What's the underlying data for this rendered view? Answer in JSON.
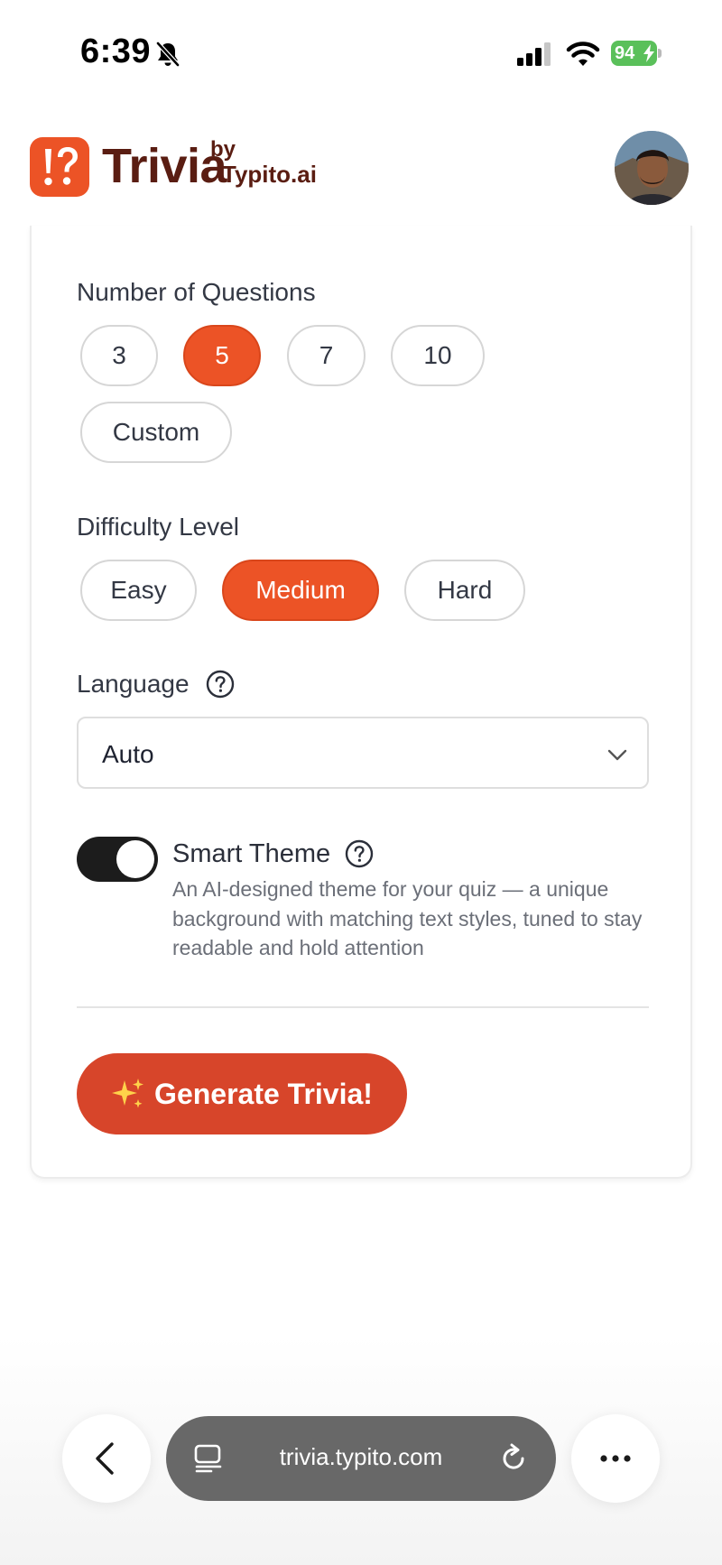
{
  "status_bar": {
    "time": "6:39",
    "battery": "94",
    "icons": [
      "bell-slash-icon",
      "cell-signal-icon",
      "wifi-icon",
      "battery-charging-icon"
    ]
  },
  "header": {
    "app_name": "Trivia",
    "by": "by",
    "brand": "Typito.ai",
    "logo_icon": "exclaim-question-icon",
    "avatar": "user-avatar"
  },
  "form": {
    "questions": {
      "label": "Number of Questions",
      "options": [
        "3",
        "5",
        "7",
        "10",
        "Custom"
      ],
      "selected": "5"
    },
    "difficulty": {
      "label": "Difficulty Level",
      "options": [
        "Easy",
        "Medium",
        "Hard"
      ],
      "selected": "Medium"
    },
    "language": {
      "label": "Language",
      "value": "Auto"
    },
    "smart_theme": {
      "title": "Smart Theme",
      "enabled": true,
      "description": "An AI-designed theme for your quiz — a unique background with matching text styles, tuned to stay readable and hold attention"
    },
    "generate_label": "Generate Trivia!"
  },
  "browser": {
    "url": "trivia.typito.com"
  },
  "colors": {
    "accent": "#ec5326",
    "button": "#d7452a",
    "brand_text": "#5a1d12",
    "toggle_on": "#1c1c1c"
  }
}
